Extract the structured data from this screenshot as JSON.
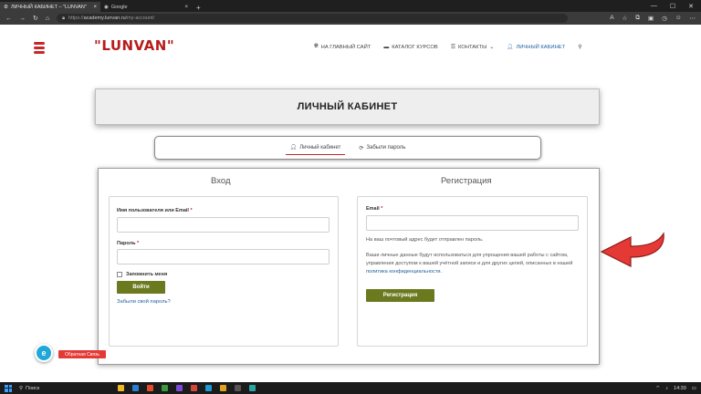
{
  "browser": {
    "tabs": [
      {
        "label": "ЛИЧНЫЙ КАБИНЕТ – \"LUNVAN\"",
        "active": true
      },
      {
        "label": "Google",
        "active": false
      }
    ],
    "url_prefix": "https://",
    "url_host": "academy.lunvan.ru",
    "url_path": "/my-account/"
  },
  "site": {
    "logo": "\"LUNVAN\"",
    "nav": [
      {
        "label": "НА ГЛАВНЫЙ САЙТ",
        "icon": "globe-icon"
      },
      {
        "label": "КАТАЛОГ КУРСОВ",
        "icon": "folder-icon"
      },
      {
        "label": "КОНТАКТЫ",
        "icon": "list-icon"
      },
      {
        "label": "ЛИЧНЫЙ КАБИНЕТ",
        "icon": "user-icon"
      }
    ]
  },
  "page": {
    "title": "ЛИЧНЫЙ КАБИНЕТ",
    "tabs": [
      "Личный кабинет",
      "Забыли пароль"
    ]
  },
  "login": {
    "heading": "Вход",
    "username_label": "Имя пользователя или Email",
    "password_label": "Пароль",
    "remember_label": "Запомнить меня",
    "submit": "Войти",
    "lost_password": "Забыли свой пароль?"
  },
  "register": {
    "heading": "Регистрация",
    "email_label": "Email",
    "note": "На ваш почтовый адрес будет отправлен пароль.",
    "privacy_text": "Ваши личные данные будут использоваться для упрощения вашей работы с сайтом, управления доступом к вашей учётной записи и для других целей, описанных в нашей",
    "privacy_link": "политика конфиденциальности",
    "submit": "Регистрация"
  },
  "widgets": {
    "chat_icon": "e",
    "feedback": "Обратная Связь"
  },
  "taskbar": {
    "search": "Поиск",
    "time": "14:39"
  },
  "colors": {
    "accent_red": "#c62828",
    "button_olive": "#6b7a1f",
    "link_blue": "#1e5f9e"
  }
}
